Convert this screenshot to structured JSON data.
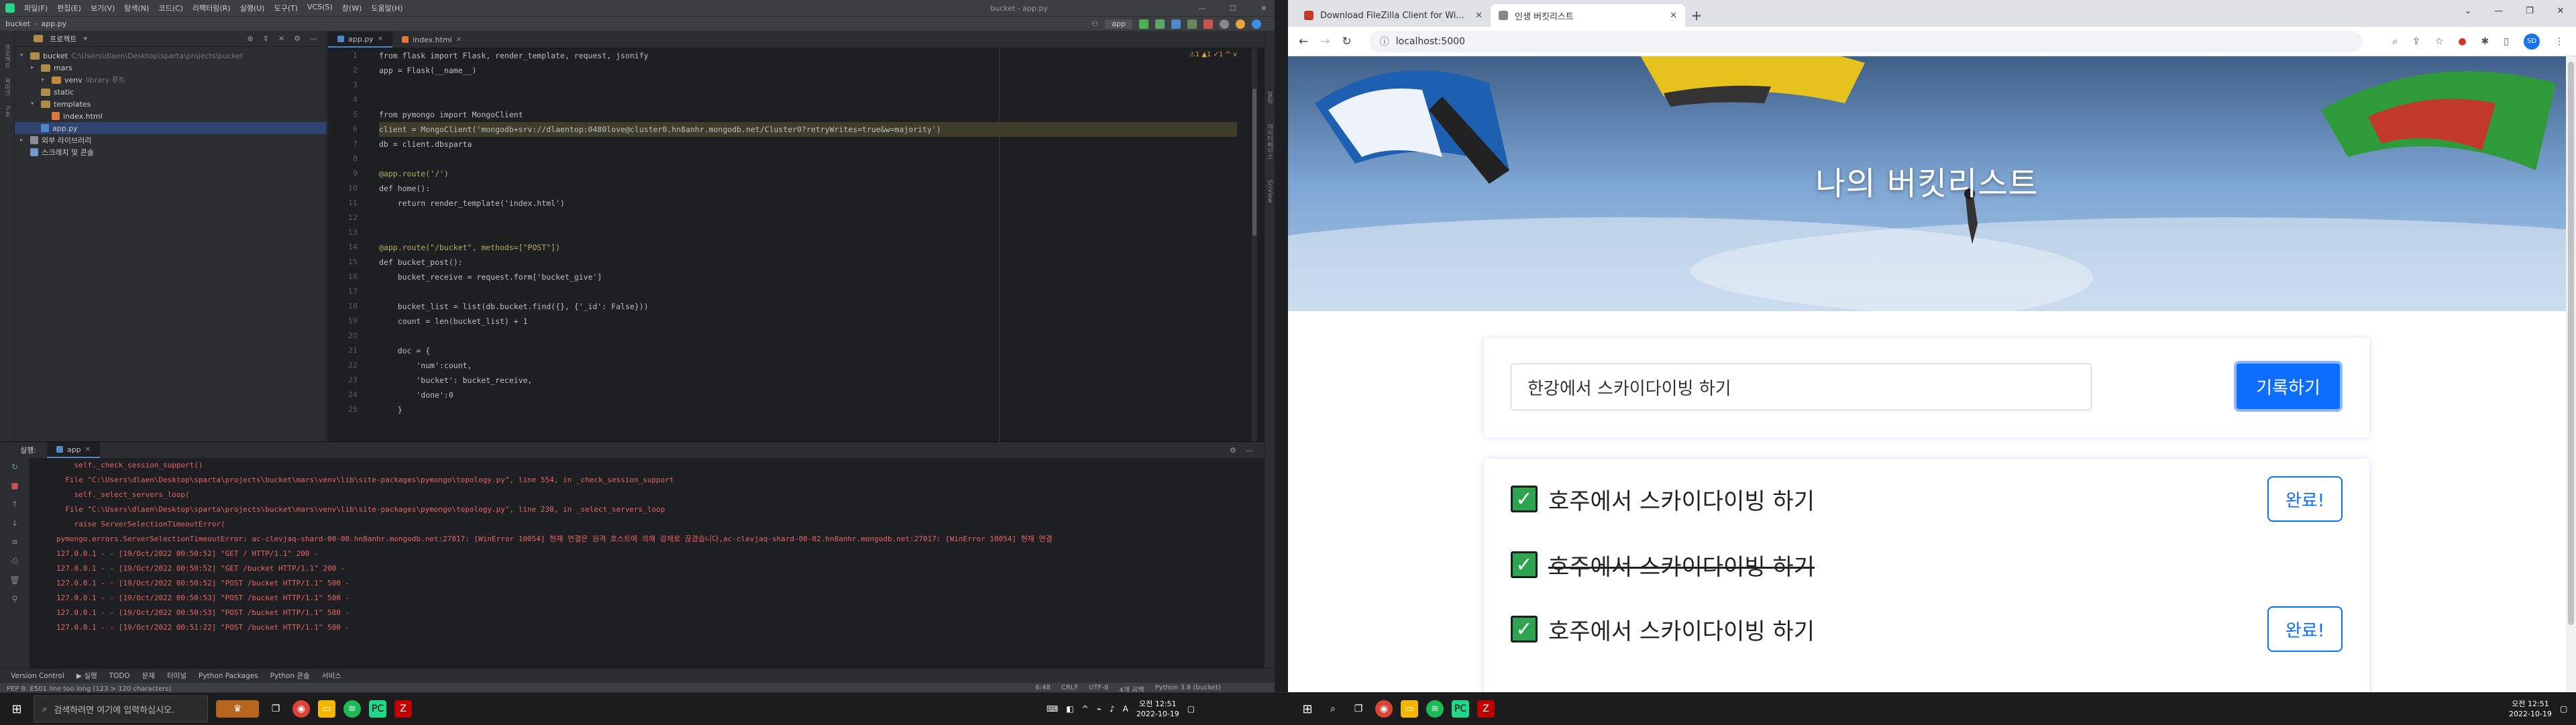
{
  "ide": {
    "menu": [
      "파일(F)",
      "편집(E)",
      "보기(V)",
      "탐색(N)",
      "코드(C)",
      "리팩터링(R)",
      "실행(U)",
      "도구(T)",
      "VCS(S)",
      "창(W)",
      "도움말(H)"
    ],
    "window_title": "bucket - app.py",
    "breadcrumb_project": "bucket",
    "breadcrumb_file": "app.py",
    "run_config": "app",
    "project_panel_title": "프로젝트",
    "tree": [
      {
        "label": "bucket",
        "detail": "C:\\Users\\dlaen\\Desktop\\sparta\\projects\\bucket",
        "indent": 0,
        "arrow": "▾",
        "type": "folder"
      },
      {
        "label": "mars",
        "detail": "",
        "indent": 1,
        "arrow": "▸",
        "type": "folder"
      },
      {
        "label": "venv",
        "detail": "library 루트",
        "indent": 2,
        "arrow": "▸",
        "type": "folder",
        "selected_dim": true
      },
      {
        "label": "static",
        "detail": "",
        "indent": 1,
        "arrow": "",
        "type": "folder"
      },
      {
        "label": "templates",
        "detail": "",
        "indent": 1,
        "arrow": "▾",
        "type": "folder"
      },
      {
        "label": "index.html",
        "detail": "",
        "indent": 2,
        "arrow": "",
        "type": "html"
      },
      {
        "label": "app.py",
        "detail": "",
        "indent": 1,
        "arrow": "",
        "type": "py",
        "selected": true
      },
      {
        "label": "외부 라이브러리",
        "detail": "",
        "indent": 0,
        "arrow": "▸",
        "type": "lib"
      },
      {
        "label": "스크래치 및 콘솔",
        "detail": "",
        "indent": 0,
        "arrow": "",
        "type": "scratch"
      }
    ],
    "tabs": [
      {
        "label": "app.py",
        "active": true
      },
      {
        "label": "index.html",
        "active": false
      }
    ],
    "inspections": "⚠1 ▲1 ✓1 ^ v",
    "code_lines": [
      "from flask import Flask, render_template, request, jsonify",
      "app = Flask(__name__)",
      "",
      "",
      "from pymongo import MongoClient",
      "client = MongoClient('mongodb+srv://dlaentop:0480love@cluster0.hn8anhr.mongodb.net/Cluster0?retryWrites=true&w=majority')",
      "db = client.dbsparta",
      "",
      "@app.route('/')",
      "def home():",
      "    return render_template('index.html')",
      "",
      "",
      "@app.route(\"/bucket\", methods=[\"POST\"])",
      "def bucket_post():",
      "    bucket_receive = request.form['bucket_give']",
      "",
      "    bucket_list = list(db.bucket.find({}, {'_id': False}))",
      "    count = len(bucket_list) + 1",
      "",
      "    doc = {",
      "        'num':count,",
      "        'bucket': bucket_receive,",
      "        'done':0",
      "    }"
    ],
    "run_tab_label": "실행:",
    "run_tab_name": "app",
    "console_lines": [
      {
        "text": "    self._check_session_support()",
        "cls": "c-red"
      },
      {
        "text": "  File \"C:\\Users\\dlaen\\Desktop\\sparta\\projects\\bucket\\mars\\venv\\lib\\site-packages\\pymongo\\topology.py\", line 554, in _check_session_support",
        "cls": "c-red"
      },
      {
        "text": "    self._select_servers_loop(",
        "cls": "c-red"
      },
      {
        "text": "  File \"C:\\Users\\dlaen\\Desktop\\sparta\\projects\\bucket\\mars\\venv\\lib\\site-packages\\pymongo\\topology.py\", line 238, in _select_servers_loop",
        "cls": "c-red"
      },
      {
        "text": "    raise ServerSelectionTimeoutError(",
        "cls": "c-red"
      },
      {
        "text": "pymongo.errors.ServerSelectionTimeoutError: ac-clevjaq-shard-00-00.hn8anhr.mongodb.net:27017: [WinError 10054] 현재 연결은 원격 호스트에 의해 강제로 끊겼습니다,ac-clevjaq-shard-00-02.hn8anhr.mongodb.net:27017: [WinError 10054] 현재 연결",
        "cls": "c-red"
      },
      {
        "text": "127.0.0.1 - - [19/Oct/2022 00:50:52] \"GET / HTTP/1.1\" 200 -",
        "cls": "c-red"
      },
      {
        "text": "127.0.0.1 - - [19/Oct/2022 00:50:52] \"GET /bucket HTTP/1.1\" 200 -",
        "cls": "c-red"
      },
      {
        "text": "127.0.0.1 - - [19/Oct/2022 00:50:52] \"POST /bucket HTTP/1.1\" 500 -",
        "cls": "c-red"
      },
      {
        "text": "127.0.0.1 - - [19/Oct/2022 00:50:53] \"POST /bucket HTTP/1.1\" 500 -",
        "cls": "c-red"
      },
      {
        "text": "127.0.0.1 - - [19/Oct/2022 00:50:53] \"POST /bucket HTTP/1.1\" 500 -",
        "cls": "c-red"
      },
      {
        "text": "127.0.0.1 - - [19/Oct/2022 00:51:22] \"POST /bucket HTTP/1.1\" 500 -",
        "cls": "c-red"
      }
    ],
    "bottom_tools": [
      "Version Control",
      "▶ 실행",
      "TODO",
      "문제",
      "터미널",
      "Python Packages",
      "Python 콘솔",
      "서비스"
    ],
    "status_left": "PEP 8: E501 line too long (123 > 120 characters)",
    "status_right": [
      "6:48",
      "CRLF",
      "UTF-8",
      "4개 공백",
      "Python 3.8 (bucket)"
    ]
  },
  "browser": {
    "tabs": [
      {
        "label": "Download FileZilla Client for Wi...",
        "active": false,
        "icon_color": "#c0392b"
      },
      {
        "label": "인생 버킷리스트",
        "active": true,
        "icon_color": "#888888"
      }
    ],
    "url": "localhost:5000",
    "avatar": "SD",
    "page": {
      "hero_title": "나의 버킷리스트",
      "input_value": "한강에서 스카이다이빙 하기",
      "save_label": "기록하기",
      "items": [
        {
          "text": "호주에서 스카이다이빙 하기",
          "done": false,
          "button": "완료!"
        },
        {
          "text": "호주에서 스카이다이빙 하기",
          "done": true,
          "button": ""
        },
        {
          "text": "호주에서 스카이다이빙 하기",
          "done": false,
          "button": "완료!"
        }
      ]
    }
  },
  "taskbar": {
    "search_placeholder": "검색하려면 여기에 입력하십시오.",
    "left_time": "오전 12:51",
    "left_date": "2022-10-19",
    "right_time": "오전 12:51",
    "right_date": "2022-10-19"
  },
  "colors": {
    "accent": "#0d6efd",
    "check": "#2ea44f",
    "ide_bg": "#1e1f22"
  }
}
